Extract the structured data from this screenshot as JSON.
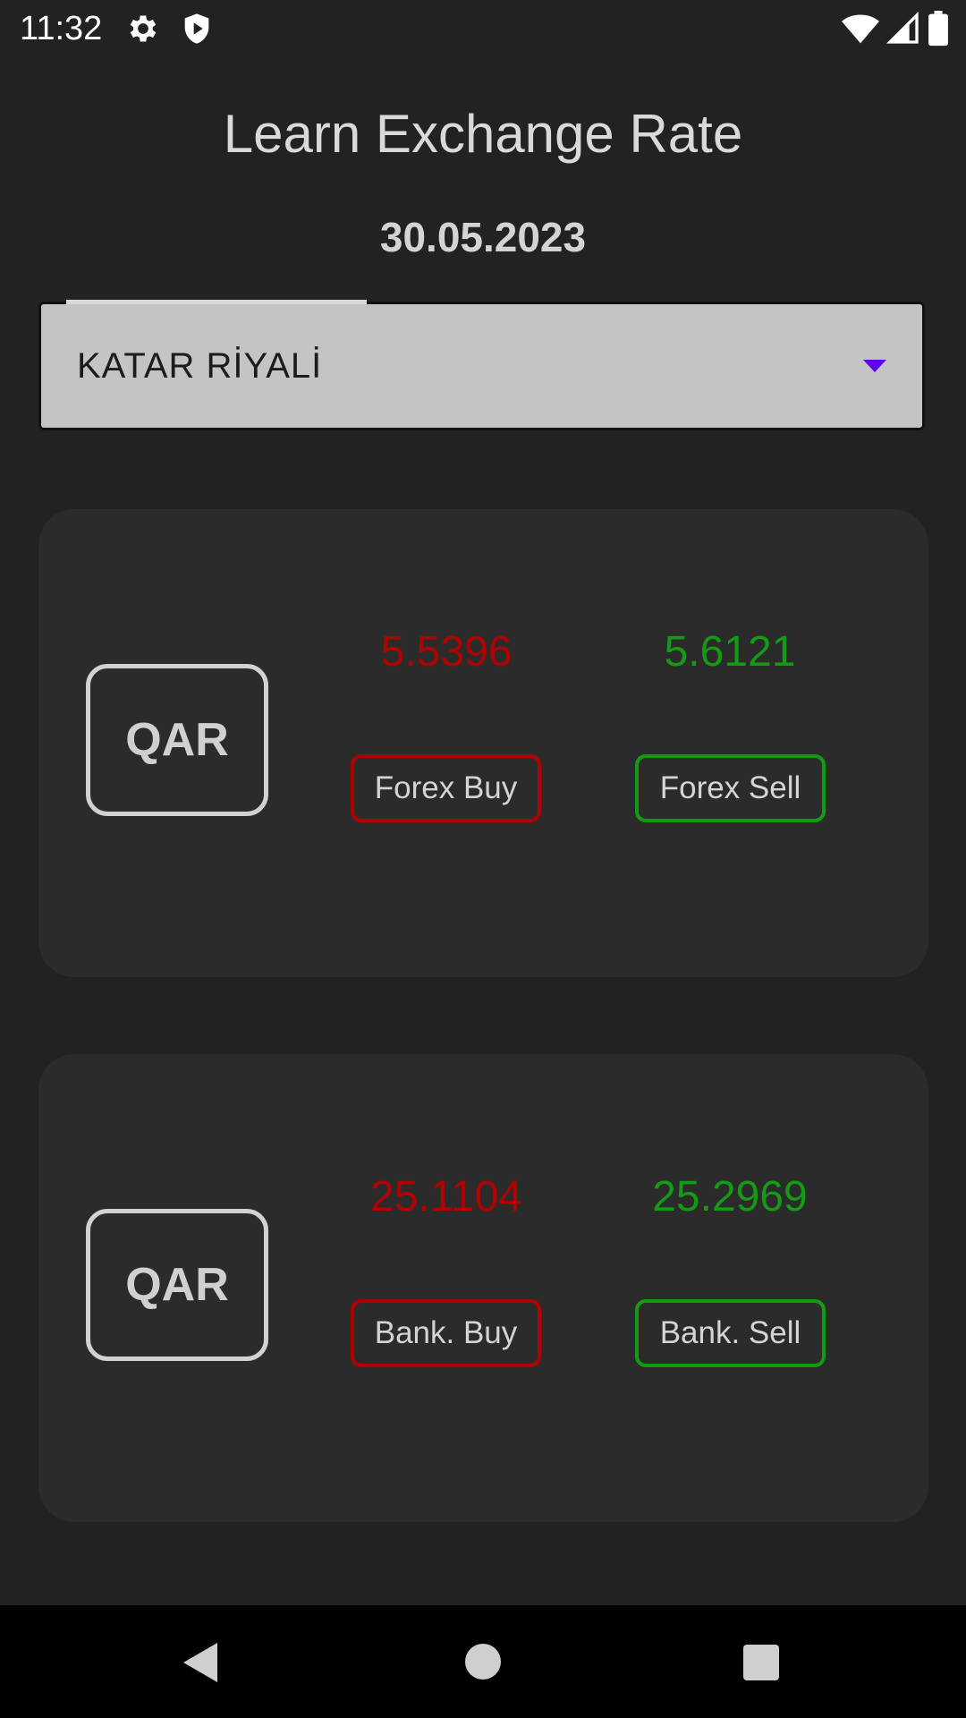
{
  "status_bar": {
    "time": "11:32",
    "icons": [
      "gear-icon",
      "shield-icon",
      "wifi-icon",
      "signal-icon",
      "battery-icon"
    ]
  },
  "app": {
    "title": "Learn Exchange Rate",
    "date": "30.05.2023"
  },
  "currency_select": {
    "selected": "KATAR RİYALİ",
    "arrow_color": "#6200ee"
  },
  "forex": {
    "code": "QAR",
    "buy_value": "5.5396",
    "sell_value": "5.6121",
    "buy_label": "Forex Buy",
    "sell_label": "Forex Sell"
  },
  "bank": {
    "code": "QAR",
    "buy_value": "25.1104",
    "sell_value": "25.2969",
    "buy_label": "Bank. Buy",
    "sell_label": "Bank. Sell"
  },
  "colors": {
    "buy": "#b00000",
    "sell": "#159a15",
    "background": "#222222",
    "card": "#2b2b2b"
  },
  "nav_bar": {
    "buttons": [
      "back-icon",
      "home-icon",
      "recents-icon"
    ]
  }
}
